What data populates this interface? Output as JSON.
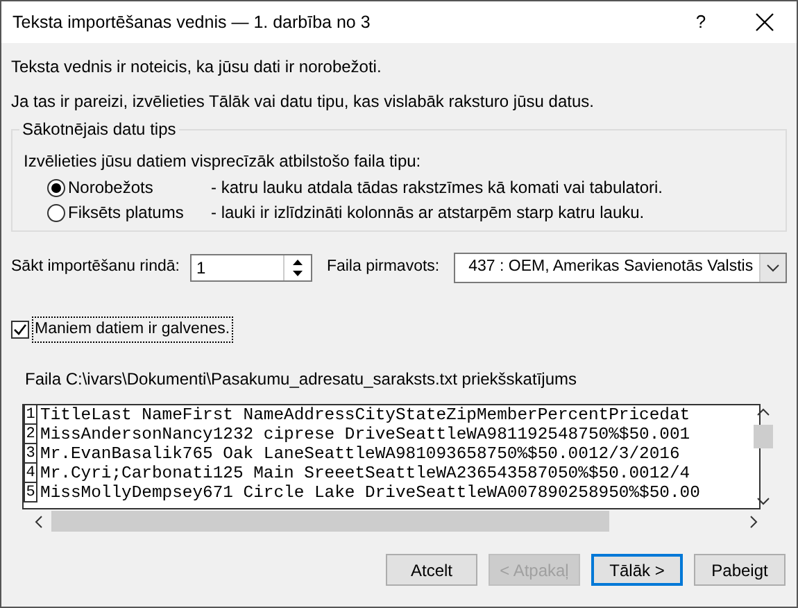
{
  "window": {
    "title": "Teksta importēšanas vednis — 1. darbība no 3",
    "help": "?"
  },
  "intro": [
    "Teksta vednis ir noteicis, ka jūsu dati ir norobežoti.",
    "Ja tas ir pareizi, izvēlieties Tālāk vai datu tipu, kas vislabāk raksturo jūsu datus."
  ],
  "data_type_group": {
    "legend": "Sākotnējais datu tips",
    "prompt": "Izvēlieties jūsu datiem visprecīzāk atbilstošo faila tipu:",
    "options": [
      {
        "label": "Norobežots",
        "description": "- katru lauku atdala tādas rakstzīmes kā komati vai tabulatori.",
        "selected": true
      },
      {
        "label": "Fiksēts platums",
        "description": "- lauki ir izlīdzināti kolonnās ar atstarpēm starp katru lauku.",
        "selected": false
      }
    ]
  },
  "start_row": {
    "label": "Sākt importēšanu rindā:",
    "value": "1"
  },
  "file_origin": {
    "label": "Faila pirmavots:",
    "value": "437 : OEM, Amerikas Savienotās Valstis"
  },
  "headers_checkbox": {
    "label": "Maniem datiem ir galvenes.",
    "checked": true
  },
  "preview": {
    "label": "Faila C:\\ivars\\Dokumenti\\Pasakumu_adresatu_saraksts.txt priekšskatījums",
    "rows": [
      {
        "number": "1",
        "text": "TitleLast NameFirst NameAddressCityStateZipMemberPercentPricedat"
      },
      {
        "number": "2",
        "text": "MissAndersonNancy1232 ciprese DriveSeattleWA981192548750%$50.001"
      },
      {
        "number": "3",
        "text": "Mr.EvanBasalik765 Oak LaneSeattleWA981093658750%$50.0012/3/2016"
      },
      {
        "number": "4",
        "text": "Mr.Cyri;Carbonati125 Main SreeetSeattleWA236543587050%$50.0012/4"
      },
      {
        "number": "5",
        "text": "MissMollyDempsey671 Circle Lake DriveSeattleWA007890258950%$50.00"
      }
    ]
  },
  "buttons": [
    {
      "label": "Atcelt",
      "disabled": false,
      "default": false
    },
    {
      "label": "< Atpakaļ",
      "disabled": true,
      "default": false
    },
    {
      "label": "Tālāk >",
      "disabled": false,
      "default": true
    },
    {
      "label": "Pabeigt",
      "disabled": false,
      "default": false
    }
  ]
}
